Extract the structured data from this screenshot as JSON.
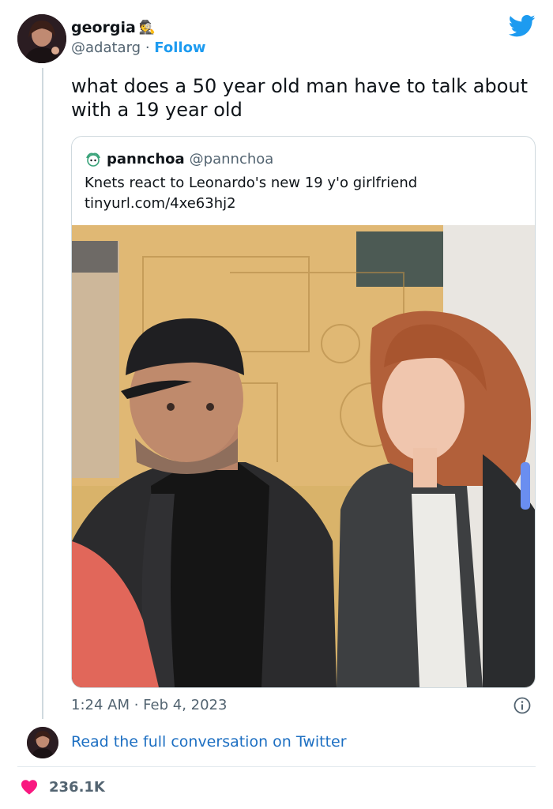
{
  "author": {
    "display_name": "georgia",
    "emoji": "🕵",
    "handle": "@adatarg",
    "separator": "·",
    "follow_label": "Follow"
  },
  "tweet": {
    "text": "what does a 50 year old man have to talk about with a 19 year old",
    "timestamp": "1:24 AM · Feb 4, 2023"
  },
  "quoted_tweet": {
    "display_name": "pannchoa",
    "handle": "@pannchoa",
    "text_line1": "Knets react to Leonardo's new 19 y'o girlfriend",
    "text_line2": "tinyurl.com/4xe63hj2"
  },
  "footer": {
    "read_full_label": "Read the full conversation on Twitter",
    "like_count": "236.1K"
  },
  "icons": {
    "brand": "twitter-bird-icon",
    "info": "info-icon",
    "like": "heart-icon"
  },
  "colors": {
    "twitter_blue": "#1d9bf0",
    "link_blue": "#1d6fc2",
    "heart_pink": "#f91880",
    "secondary_text": "#536471",
    "border": "#cfd9de"
  }
}
